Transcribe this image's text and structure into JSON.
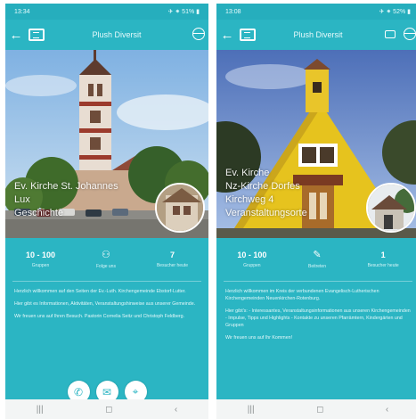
{
  "screens": [
    {
      "status": {
        "time": "13:34",
        "right": "✈ ⁕ 51% ▮"
      },
      "header": {
        "title": "Plush Diversit"
      },
      "hero": {
        "lines": [
          "Ev. Kirche St. Johannes",
          "Lux",
          "Geschichte"
        ]
      },
      "stats": [
        {
          "value": "10 - 100",
          "label": "Gruppen"
        },
        {
          "value": "",
          "label": "Folge uns"
        },
        {
          "value": "7",
          "label": "Besucher heute"
        }
      ],
      "description": [
        "Herzlich willkommen auf den Seiten der Ev.-Luth. Kirchengemeinde Ebstorf-Lutter.",
        "Hier gibt es Informationen, Aktivitäten, Veranstaltungshinweise aus unserer Gemeinde.",
        "Wir freuen uns auf Ihren Besuch. Pastorin Cornelia Seitz und Christoph Feldberg."
      ],
      "actions": [
        {
          "icon": "✆",
          "name": "phone"
        },
        {
          "icon": "✉",
          "name": "email"
        },
        {
          "icon": "⌖",
          "name": "location"
        }
      ],
      "nav": [
        "|||",
        "◻",
        "‹"
      ]
    },
    {
      "status": {
        "time": "13:08",
        "right": "✈ ⁕ 52% ▮"
      },
      "header": {
        "title": "Plush Diversit"
      },
      "hero": {
        "lines": [
          "Ev. Kirche",
          "Nz-Kirche Dorfes",
          "Kirchweg 4",
          "Veranstaltungsorte"
        ]
      },
      "stats": [
        {
          "value": "10 - 100",
          "label": "Gruppen"
        },
        {
          "value": "",
          "label": "Beitreten"
        },
        {
          "value": "1",
          "label": "Besucher heute"
        }
      ],
      "description": [
        "Herzlich willkommen im Kreis der verbundenen Evangelisch-Lutherischen Kirchengemeinden Neuenkirchen-Rotenburg.",
        "Hier gibt's: - Interessantes, Veranstaltungsinformationen aus unseren Kirchengemeinden - Impulse, Tipps und Highlights - Kontakte zu unseren Pfarrämtern, Kindergärten und Gruppen",
        "Wir freuen uns auf Ihr Kommen!"
      ],
      "nav": [
        "|||",
        "◻",
        "‹"
      ]
    }
  ]
}
